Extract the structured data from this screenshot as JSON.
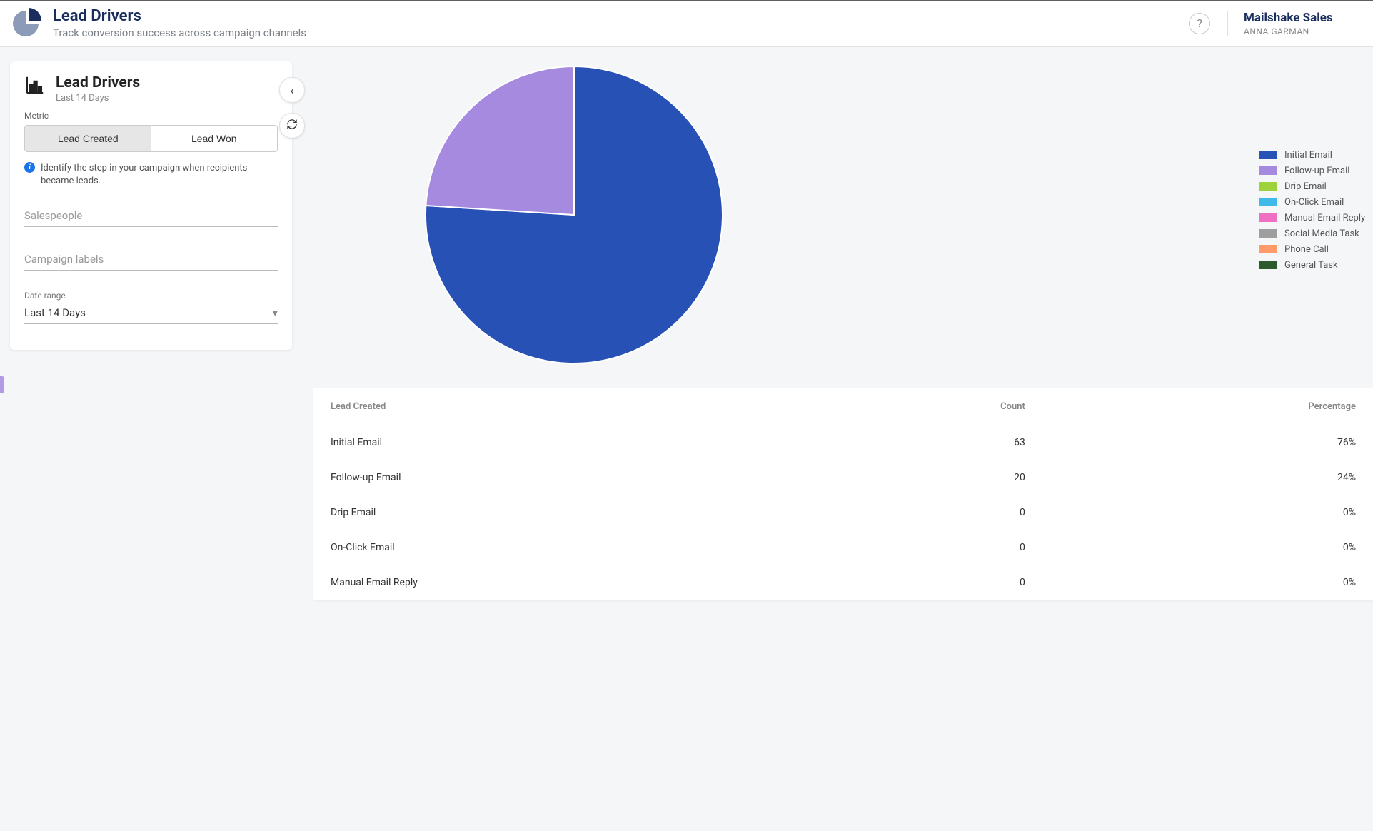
{
  "header": {
    "title": "Lead Drivers",
    "subtitle": "Track conversion success across campaign channels",
    "help_icon": "question-icon"
  },
  "account": {
    "company": "Mailshake Sales",
    "user": "ANNA GARMAN"
  },
  "sidebar": {
    "icon": "bar-chart-icon",
    "title": "Lead Drivers",
    "range": "Last 14 Days",
    "nav_back_icon": "chevron-left-icon",
    "refresh_icon": "refresh-icon",
    "metric_label": "Metric",
    "metric_tabs": [
      {
        "label": "Lead Created",
        "active": true
      },
      {
        "label": "Lead Won",
        "active": false
      }
    ],
    "hint": "Identify the step in your campaign when recipients became leads.",
    "filters": {
      "salespeople_placeholder": "Salespeople",
      "campaign_labels_placeholder": "Campaign labels",
      "date_range_label": "Date range",
      "date_range_value": "Last 14 Days"
    }
  },
  "chart_data": {
    "type": "pie",
    "title": "",
    "series": [
      {
        "name": "Initial Email",
        "value": 76,
        "color": "#2851b6"
      },
      {
        "name": "Follow-up Email",
        "value": 24,
        "color": "#a58ae0"
      },
      {
        "name": "Drip Email",
        "value": 0,
        "color": "#9ed23b"
      },
      {
        "name": "On-Click Email",
        "value": 0,
        "color": "#3eb9e8"
      },
      {
        "name": "Manual Email Reply",
        "value": 0,
        "color": "#ef6fc3"
      },
      {
        "name": "Social Media Task",
        "value": 0,
        "color": "#9e9e9e"
      },
      {
        "name": "Phone Call",
        "value": 0,
        "color": "#ff9b6a"
      },
      {
        "name": "General Task",
        "value": 0,
        "color": "#2e5b2e"
      }
    ]
  },
  "table": {
    "columns": [
      "Lead Created",
      "Count",
      "Percentage"
    ],
    "rows": [
      {
        "label": "Initial Email",
        "count": 63,
        "percentage": "76%"
      },
      {
        "label": "Follow-up Email",
        "count": 20,
        "percentage": "24%"
      },
      {
        "label": "Drip Email",
        "count": 0,
        "percentage": "0%"
      },
      {
        "label": "On-Click Email",
        "count": 0,
        "percentage": "0%"
      },
      {
        "label": "Manual Email Reply",
        "count": 0,
        "percentage": "0%"
      }
    ]
  }
}
